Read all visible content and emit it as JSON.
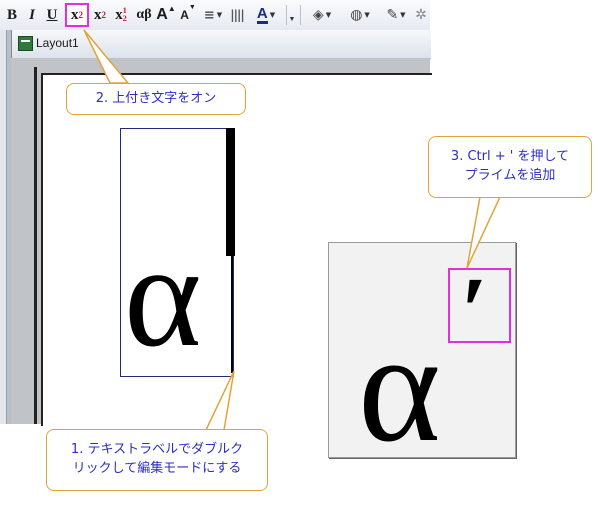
{
  "toolbar": {
    "bold_label": "B",
    "italic_label": "I",
    "underline_label": "U",
    "superscript_base": "x",
    "superscript_mark": "2",
    "subscript_base": "x",
    "subscript_mark": "2",
    "supsub_base": "x",
    "supsub_top": "1",
    "supsub_bottom": "2",
    "greek_label": "αβ",
    "grow_font_label": "A",
    "shrink_font_label": "A",
    "font_color_label": "A"
  },
  "window": {
    "title": "Layout1"
  },
  "label_text": "α",
  "result_text": "α",
  "prime_char": "′",
  "callouts": {
    "step1": [
      "1. テキストラベルでダブルク",
      "リックして編集モードにする"
    ],
    "step2": "2. 上付き文字をオン",
    "step3": [
      "3. Ctrl + ' を押して",
      "プライムを追加"
    ]
  },
  "colors": {
    "callout_border": "#e0a43a",
    "callout_text": "#2d2dc8",
    "highlight": "#e02fe0"
  }
}
